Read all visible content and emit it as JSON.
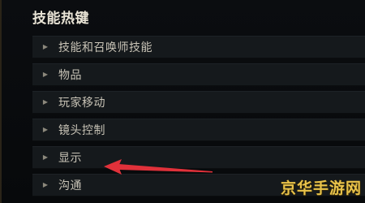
{
  "panel": {
    "title": "技能热键",
    "items": [
      {
        "label": "技能和召唤师技能",
        "caret_icon": "triangle-right-icon"
      },
      {
        "label": "物品",
        "caret_icon": "triangle-right-icon"
      },
      {
        "label": "玩家移动",
        "caret_icon": "triangle-right-icon"
      },
      {
        "label": "镜头控制",
        "caret_icon": "triangle-right-icon"
      },
      {
        "label": "显示",
        "caret_icon": "triangle-right-icon"
      },
      {
        "label": "沟通",
        "caret_icon": "triangle-right-icon"
      }
    ]
  },
  "annotation": {
    "arrow_color": "#e0313a",
    "points_to": "显示"
  },
  "watermark": {
    "text": "京华手游网",
    "color": "#e8c24a"
  },
  "colors": {
    "background": "#050607",
    "row_background": "#15191c",
    "title_text": "#e9e4d6",
    "item_text": "#c8c3b6"
  }
}
